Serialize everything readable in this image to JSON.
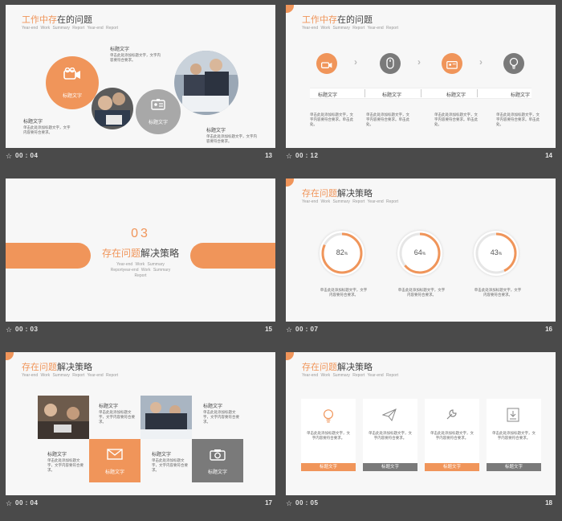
{
  "colors": {
    "accent": "#f0955a",
    "gray": "#888888",
    "bg": "#4a4a4a"
  },
  "common": {
    "label": "标题文字",
    "body_text": "单击此处添加标题文字，文字内容要符合要求。",
    "body_short": "单击此处添加标题文字，文字内容要符合要求。",
    "body_small": "单击此处添加标题文字，单击此处。"
  },
  "slides": [
    {
      "number": "13",
      "duration": "00 : 04",
      "title_accent": "工作中存",
      "title_rest": "在的问题",
      "subtitle": "Year-end Work Summary Report Year-end Report",
      "items": [
        {
          "label": "标题文字",
          "text": "单击此处添加标题文字，文字内容要符合要求。"
        },
        {
          "label": "标题文字",
          "text": "单击此处添加标题文字，文字内容要符合要求。"
        },
        {
          "label": "标题文字",
          "text": "单击此处添加标题文字，文字内容要符合要求。"
        }
      ],
      "circle_labels": [
        "标题文字",
        "标题文字"
      ],
      "icons": [
        "video-camera-icon",
        "id-card-icon"
      ]
    },
    {
      "number": "14",
      "duration": "00 : 12",
      "title_accent": "工作中存",
      "title_rest": "在的问题",
      "subtitle": "Year-end Work Summary Report Year-end Report",
      "steps": [
        {
          "label": "标题文字",
          "text": "单击此处添加标题文字，文字内容要符合要求。单击此处。",
          "icon": "video-camera-icon"
        },
        {
          "label": "标题文字",
          "text": "单击此处添加标题文字，文字内容要符合要求。单击此处。",
          "icon": "mouse-icon"
        },
        {
          "label": "标题文字",
          "text": "单击此处添加标题文字，文字内容要符合要求。单击此处。",
          "icon": "id-card-icon"
        },
        {
          "label": "标题文字",
          "text": "单击此处添加标题文字，文字内容要符合要求。单击此处。",
          "icon": "lightbulb-icon"
        }
      ]
    },
    {
      "number": "15",
      "duration": "00 : 03",
      "section_number": "03",
      "title_accent": "存在问题",
      "title_rest": "解决策略",
      "subtitle": "Year-end Work Summary Reportyear-end Work Summary Report"
    },
    {
      "number": "16",
      "duration": "00 : 07",
      "title_accent": "存在问题",
      "title_rest": "解决策略",
      "subtitle": "Year-end Work Summary Report Year-end Report",
      "rings": [
        {
          "value": 82,
          "display": "82",
          "unit": "%",
          "text": "单击此处添加标题文字，文字内容要符合要求。"
        },
        {
          "value": 64,
          "display": "64",
          "unit": "%",
          "text": "单击此处添加标题文字，文字内容要符合要求。"
        },
        {
          "value": 43,
          "display": "43",
          "unit": "%",
          "text": "单击此处添加标题文字，文字内容要符合要求。"
        }
      ]
    },
    {
      "number": "17",
      "duration": "00 : 04",
      "title_accent": "存在问题",
      "title_rest": "解决策略",
      "subtitle": "Year-end Work Summary Report Year-end Report",
      "items": [
        {
          "label": "标题文字",
          "text": "单击此处添加标题文字，文字内容要符合要求。"
        },
        {
          "label": "标题文字",
          "text": "单击此处添加标题文字，文字内容要符合要求。"
        },
        {
          "label": "标题文字",
          "text": "单击此处添加标题文字，文字内容要符合要求。"
        },
        {
          "label": "标题文字",
          "text": "单击此处添加标题文字，文字内容要符合要求。"
        }
      ],
      "tile_labels": [
        "标题文字",
        "标题文字"
      ],
      "icons": [
        "envelope-icon",
        "camera-icon"
      ]
    },
    {
      "number": "18",
      "duration": "00 : 05",
      "title_accent": "存在问题",
      "title_rest": "解决策略",
      "subtitle": "Year-end Work Summary Report Year-end Report",
      "cards": [
        {
          "label": "标题文字",
          "text": "单击此处添加标题文字，文字内容要符合要求。",
          "icon": "lightbulb-icon"
        },
        {
          "label": "标题文字",
          "text": "单击此处添加标题文字，文字内容要符合要求。",
          "icon": "paper-plane-icon"
        },
        {
          "label": "标题文字",
          "text": "单击此处添加标题文字，文字内容要符合要求。",
          "icon": "wrench-icon"
        },
        {
          "label": "标题文字",
          "text": "单击此处添加标题文字，文字内容要符合要求。",
          "icon": "download-icon"
        }
      ]
    }
  ]
}
